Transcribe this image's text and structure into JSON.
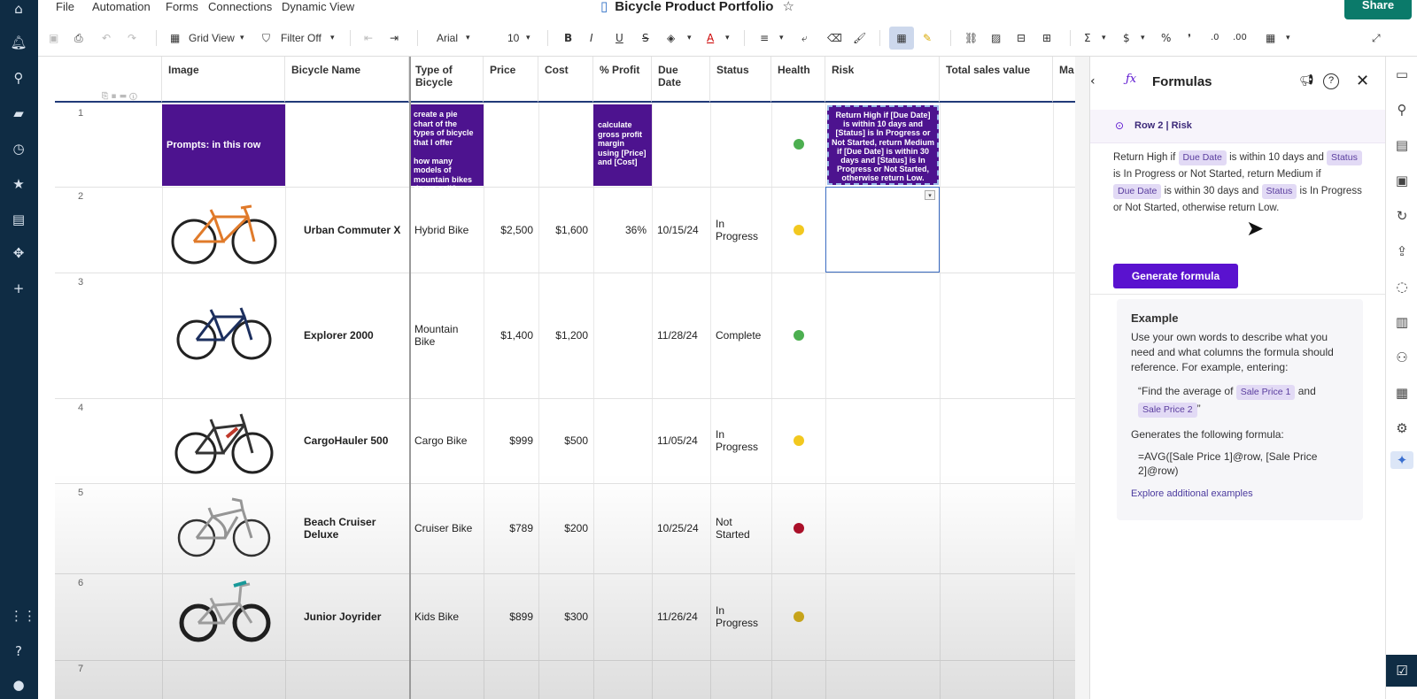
{
  "app": {
    "title": "Bicycle Product Portfolio",
    "share_label": "Share"
  },
  "menu": [
    "File",
    "Automation",
    "Forms",
    "Connections",
    "Dynamic View"
  ],
  "toolbar": {
    "view": "Grid View",
    "filter": "Filter Off",
    "font": "Arial",
    "size": "10"
  },
  "columns": [
    "Image",
    "Bicycle Name",
    "Type of Bicycle",
    "Price",
    "Cost",
    "% Profit",
    "Due Date",
    "Status",
    "Health",
    "Risk",
    "Total sales value",
    "Ma"
  ],
  "prompt_row": {
    "image": "Prompts: in this row",
    "type": "create a pie chart of the types of bicycle that I offer\n\nhow many models of mountain bikes do we sell?",
    "profit": "calculate gross profit margin using [Price] and [Cost]",
    "risk": "Return High if [Due Date] is within 10 days and [Status] is In Progress or Not Started, return Medium if [Due Date] is within 30 days and [Status] is In Progress or Not Started, otherwise return Low."
  },
  "rows": [
    {
      "num": "1"
    },
    {
      "num": "2",
      "name": "Urban Commuter X",
      "type": "Hybrid Bike",
      "price": "$2,500",
      "cost": "$1,600",
      "profit": "36%",
      "due": "10/15/24",
      "status": "In Progress",
      "health": "#f2c81f"
    },
    {
      "num": "3",
      "name": "Explorer 2000",
      "type": "Mountain Bike",
      "price": "$1,400",
      "cost": "$1,200",
      "profit": "",
      "due": "11/28/24",
      "status": "Complete",
      "health": "#4caf50"
    },
    {
      "num": "4",
      "name": "CargoHauler 500",
      "type": "Cargo Bike",
      "price": "$999",
      "cost": "$500",
      "profit": "",
      "due": "11/05/24",
      "status": "In Progress",
      "health": "#f2c81f"
    },
    {
      "num": "5",
      "name": "Beach Cruiser Deluxe",
      "type": "Cruiser Bike",
      "price": "$789",
      "cost": "$200",
      "profit": "",
      "due": "10/25/24",
      "status": "Not Started",
      "health": "#b0102a"
    },
    {
      "num": "6",
      "name": "Junior Joyrider",
      "type": "Kids Bike",
      "price": "$899",
      "cost": "$300",
      "profit": "",
      "due": "11/26/24",
      "status": "In Progress",
      "health": "#d8b21c"
    },
    {
      "num": "7"
    }
  ],
  "panel": {
    "title": "Formulas",
    "context": "Row 2 | Risk",
    "prompt": {
      "t1": "Return High if",
      "c1": "Due Date",
      "t2": "is within 10 days and",
      "c2": "Status",
      "t3": "is In Progress or Not Started, return Medium if",
      "c3": "Due Date",
      "t4": "is within 30 days and",
      "c4": "Status",
      "t5": "is In Progress or Not Started, otherwise return Low."
    },
    "generate": "Generate formula",
    "example": {
      "title": "Example",
      "desc": "Use your own words to describe what you need and what columns the formula should reference. For example, entering:",
      "q1": "“Find the average of",
      "qc1": "Sale Price 1",
      "q2": "and",
      "qc2": "Sale Price 2",
      "q3": "”",
      "gen": "Generates the following formula:",
      "formula": "=AVG([Sale Price 1]@row, [Sale Price 2]@row)",
      "link": "Explore additional examples"
    }
  },
  "colors": {
    "accent": "#5a12cf",
    "prompt_fill": "#4d138f",
    "share": "#0b7a6a",
    "nav": "#0f2c44"
  }
}
